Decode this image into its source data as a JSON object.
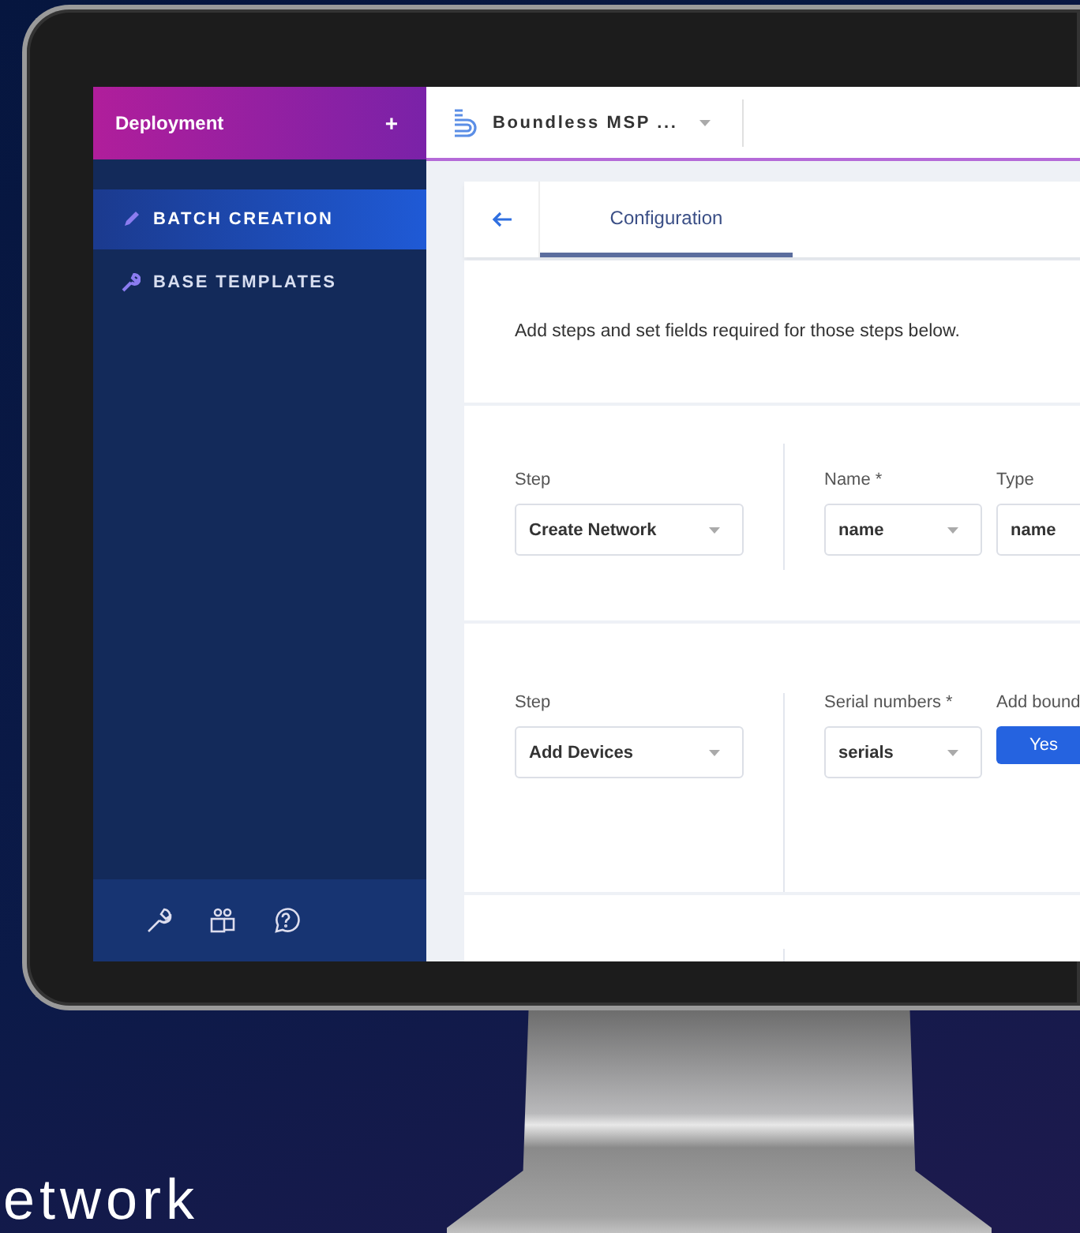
{
  "sidebar": {
    "title": "Deployment",
    "add_button": "+",
    "items": [
      {
        "label": "BATCH CREATION",
        "kind": "pencil",
        "selected": true
      },
      {
        "label": "BASE TEMPLATES",
        "kind": "wrench",
        "selected": false
      }
    ]
  },
  "org_selector": {
    "label": "Boundless MSP ..."
  },
  "tabs": [
    {
      "label": "Configuration",
      "selected": true
    }
  ],
  "description": "Add steps and set fields required for those steps below.",
  "steps": [
    {
      "step_label": "Step",
      "step_value": "Create Network",
      "fields": [
        {
          "kind": "select",
          "label": "Name *",
          "value": "name"
        },
        {
          "kind": "select",
          "label": "Type",
          "value": "name"
        }
      ]
    },
    {
      "step_label": "Step",
      "step_value": "Add Devices",
      "fields": [
        {
          "kind": "select",
          "label": "Serial numbers *",
          "value": "serials"
        },
        {
          "kind": "toggle",
          "label": "Add bound",
          "options": [
            {
              "label": "Yes",
              "selected": true
            }
          ]
        }
      ]
    }
  ],
  "tagline": "etwork"
}
